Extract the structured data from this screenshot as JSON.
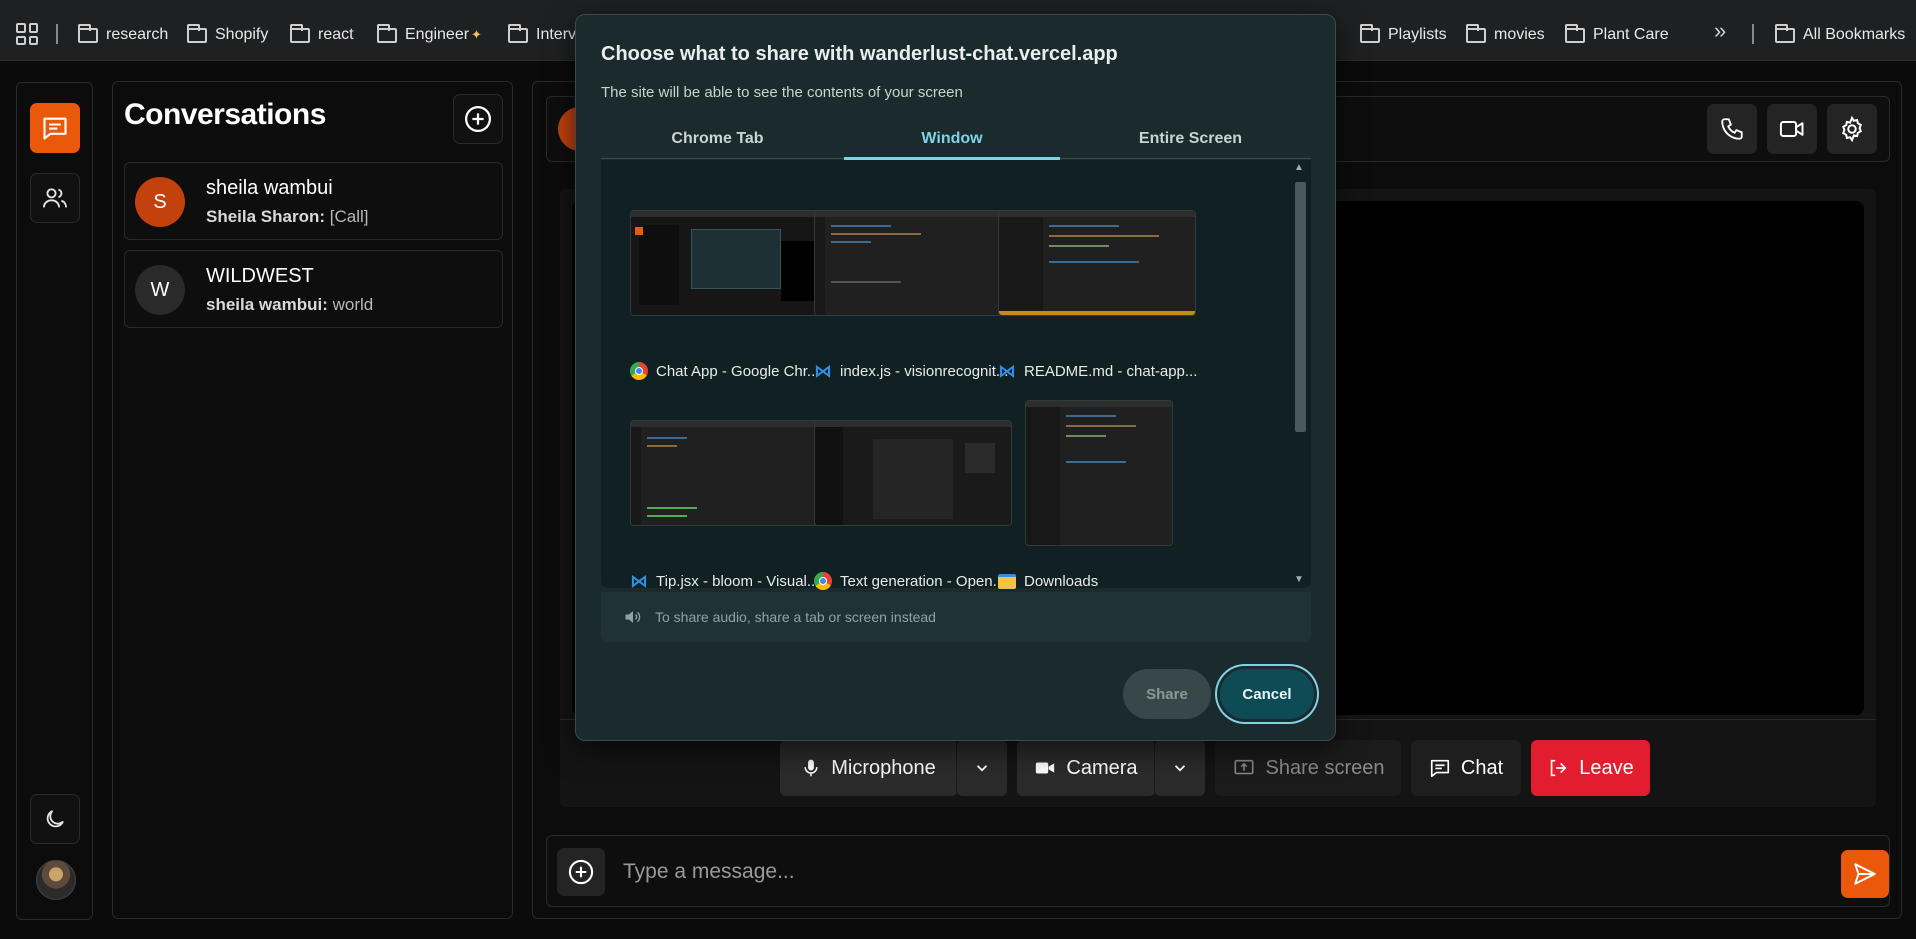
{
  "bookmarks": {
    "items": [
      "research",
      "Shopify",
      "react",
      "Engineer",
      "Interv",
      "Playlists",
      "movies",
      "Plant Care"
    ],
    "all_label": "All Bookmarks"
  },
  "sidebar": {
    "conversations_title": "Conversations",
    "conversations": [
      {
        "initial": "S",
        "name": "sheila wambui",
        "sender": "Sheila Sharon:",
        "message": "[Call]",
        "color": "#c2410c"
      },
      {
        "initial": "W",
        "name": "WILDWEST",
        "sender": "sheila wambui:",
        "message": "world",
        "color": "#2a2a2a"
      }
    ]
  },
  "header": {
    "avatar_initial": "S"
  },
  "call_controls": {
    "microphone": "Microphone",
    "camera": "Camera",
    "share_screen": "Share screen",
    "chat": "Chat",
    "leave": "Leave"
  },
  "composer": {
    "placeholder": "Type a message..."
  },
  "dialog": {
    "title": "Choose what to share with wanderlust-chat.vercel.app",
    "subtitle": "The site will be able to see the contents of your screen",
    "tabs": [
      "Chrome Tab",
      "Window",
      "Entire Screen"
    ],
    "active_tab": "Window",
    "windows": [
      {
        "label": "Chat App - Google Chr...",
        "icon": "chrome-icon"
      },
      {
        "label": "index.js - visionrecognit...",
        "icon": "vscode-icon"
      },
      {
        "label": "README.md - chat-app...",
        "icon": "vscode-icon"
      },
      {
        "label": "Tip.jsx - bloom - Visual...",
        "icon": "vscode-icon"
      },
      {
        "label": "Text generation - Open...",
        "icon": "chrome-icon"
      },
      {
        "label": "Downloads",
        "icon": "file-explorer-icon"
      }
    ],
    "audio_note": "To share audio, share a tab or screen instead",
    "share_label": "Share",
    "cancel_label": "Cancel"
  },
  "colors": {
    "accent": "#ea580c",
    "leave": "#e11d2f",
    "dialog_accent": "#7fd3e6"
  }
}
